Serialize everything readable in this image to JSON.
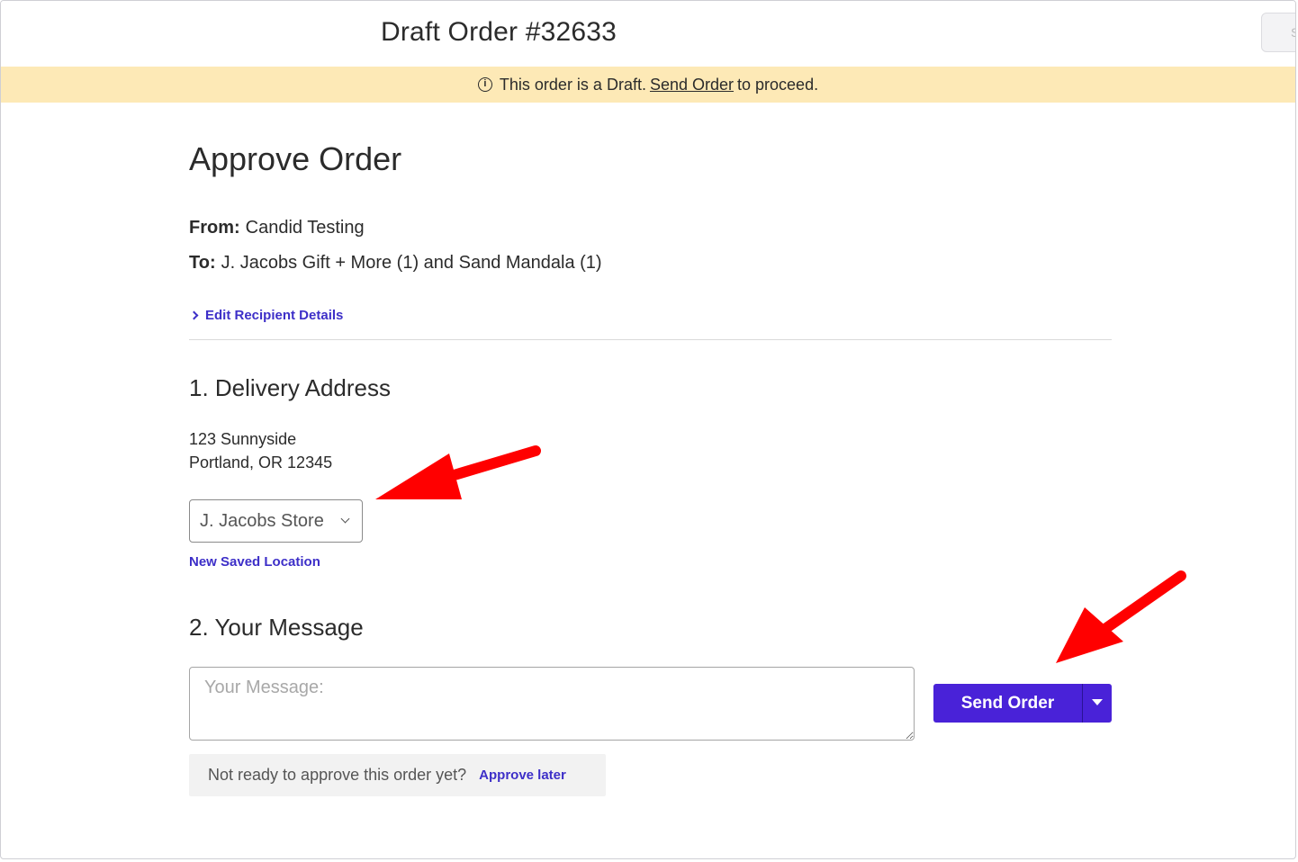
{
  "header": {
    "title": "Draft Order #32633",
    "corner_button_label": "S"
  },
  "banner": {
    "prefix": "This order is a Draft.",
    "link": "Send Order",
    "suffix": "to proceed.",
    "icon": "info-icon"
  },
  "page": {
    "heading": "Approve Order",
    "from_label": "From:",
    "from_value": "Candid Testing",
    "to_label": "To:",
    "to_value": "J. Jacobs Gift + More (1) and Sand Mandala (1)",
    "edit_recipient_link": "Edit Recipient Details"
  },
  "delivery": {
    "title": "1. Delivery Address",
    "address_line1": "123 Sunnyside",
    "address_line2": "Portland, OR 12345",
    "location_selected": "J. Jacobs Store",
    "new_location_link": "New Saved Location"
  },
  "message": {
    "title": "2. Your Message",
    "placeholder": "Your Message:"
  },
  "actions": {
    "send_button": "Send Order"
  },
  "approve_later": {
    "text": "Not ready to approve this order yet?",
    "link": "Approve later"
  },
  "colors": {
    "accent": "#4922d8",
    "link": "#3d2fc8",
    "banner_bg": "#fde9b6",
    "annotation_arrow": "#ff0000"
  }
}
